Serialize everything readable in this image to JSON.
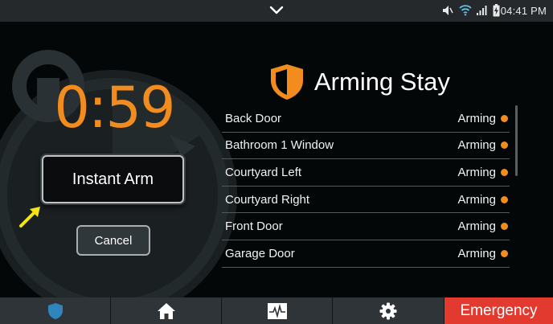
{
  "status_bar": {
    "time": "04:41 PM",
    "icons": [
      "chevron-down-icon",
      "mute-icon",
      "wifi-icon",
      "signal-icon",
      "battery-charging-icon"
    ]
  },
  "countdown": {
    "value": "0:59"
  },
  "buttons": {
    "instant_arm": "Instant Arm",
    "cancel": "Cancel"
  },
  "arming": {
    "title": "Arming Stay",
    "icon": "shield-icon",
    "accent_color": "#f28c1e"
  },
  "zones": [
    {
      "name": "Back Door",
      "status": "Arming"
    },
    {
      "name": "Bathroom 1 Window",
      "status": "Arming"
    },
    {
      "name": "Courtyard Left",
      "status": "Arming"
    },
    {
      "name": "Courtyard Right",
      "status": "Arming"
    },
    {
      "name": "Front Door",
      "status": "Arming"
    },
    {
      "name": "Garage Door",
      "status": "Arming"
    }
  ],
  "nav": {
    "items": [
      {
        "icon": "shield-icon"
      },
      {
        "icon": "home-icon"
      },
      {
        "icon": "activity-monitor-icon"
      },
      {
        "icon": "gear-icon"
      }
    ],
    "emergency_label": "Emergency",
    "emergency_color": "#e23a2f"
  }
}
